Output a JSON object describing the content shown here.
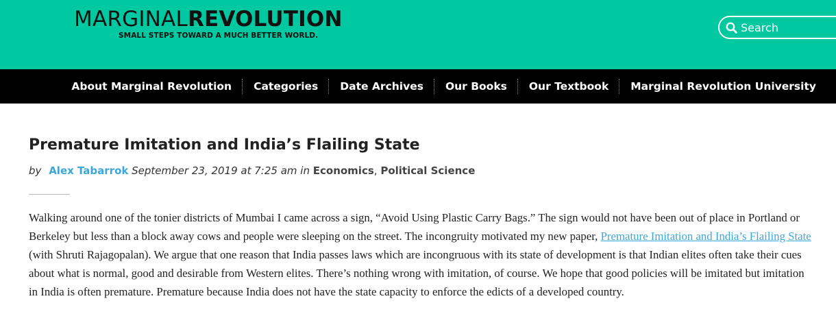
{
  "site": {
    "logo_light": "MARGINAL",
    "logo_bold": "REVOLUTION",
    "tagline": "SMALL STEPS TOWARD A MUCH BETTER WORLD.",
    "brand_color": "#00c8a0"
  },
  "search": {
    "placeholder": "Search",
    "icon": "search-icon"
  },
  "nav": {
    "items": [
      {
        "label": "About Marginal Revolution"
      },
      {
        "label": "Categories"
      },
      {
        "label": "Date Archives"
      },
      {
        "label": "Our Books"
      },
      {
        "label": "Our Textbook"
      },
      {
        "label": "Marginal Revolution University"
      }
    ]
  },
  "post": {
    "title": "Premature Imitation and India’s Flailing State",
    "by_label": "by",
    "author": "Alex Tabarrok",
    "date": "September 23, 2019 at 7:25 am",
    "in_label": "in",
    "categories": [
      "Economics",
      "Political Science"
    ],
    "category_separator": ",",
    "body_part1": "Walking around one of the tonier districts of Mumbai I came across a sign, “Avoid Using Plastic Carry Bags.” The sign would not have been out of place in Portland or Berkeley but less than a block away cows and people were sleeping on the street. The incongruity motivated my new paper, ",
    "body_link": "Premature Imitation and India’s Flailing State ",
    "body_part2": "(with Shruti Rajagopalan). We argue that one reason that India passes laws which are incongruous with its state of development is that Indian elites often take their cues about what is normal, good and desirable from Western elites. There’s nothing wrong with imitation, of course. We hope that good policies will be imitated but imitation in India is often premature. Premature because India does not have the state capacity to enforce the edicts of a developed country."
  }
}
